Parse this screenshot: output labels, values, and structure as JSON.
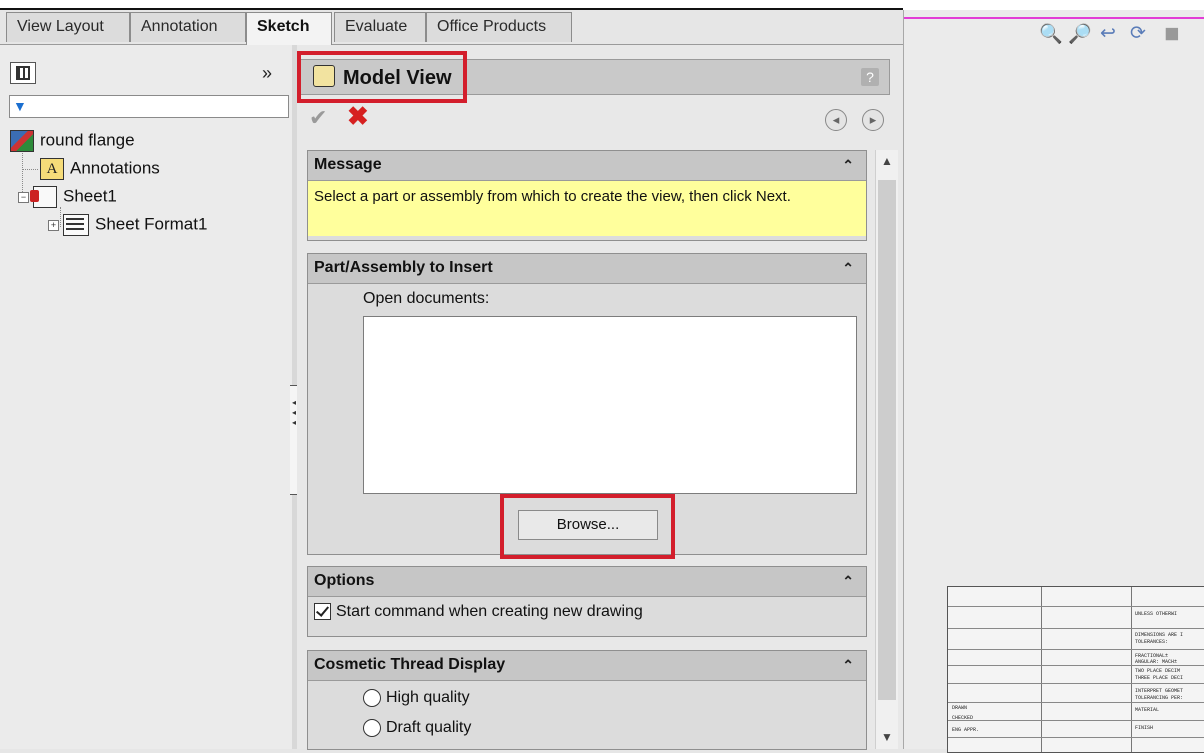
{
  "tabs": [
    {
      "label": "View Layout",
      "active": false
    },
    {
      "label": "Annotation",
      "active": false
    },
    {
      "label": "Sketch",
      "active": true
    },
    {
      "label": "Evaluate",
      "active": false
    },
    {
      "label": "Office Products",
      "active": false
    }
  ],
  "feature_tree": {
    "expand_symbol": "»",
    "filter_placeholder": "",
    "root": "round flange",
    "items": [
      "Annotations",
      "Sheet1",
      "Sheet Format1"
    ]
  },
  "property_manager": {
    "title": "Model View",
    "help": "?",
    "message": {
      "header": "Message",
      "text": "Select a part or assembly from which to create the view, then click Next."
    },
    "part_assembly": {
      "header": "Part/Assembly to Insert",
      "open_docs_label": "Open documents:",
      "browse_label": "Browse..."
    },
    "options": {
      "header": "Options",
      "start_command_label": "Start command when creating new drawing",
      "start_command_checked": true
    },
    "cosmetic": {
      "header": "Cosmetic Thread Display",
      "high_label": "High quality",
      "draft_label": "Draft quality"
    }
  },
  "title_block": {
    "lines": [
      "UNLESS OTHERWI",
      "DIMENSIONS ARE I",
      "TOLERANCES:",
      "FRACTIONAL±",
      "ANGULAR: MACH±",
      "TWO PLACE DECIM",
      "THREE PLACE DECI",
      "INTERPRET GEOMET",
      "TOLERANCING PER:",
      "MATERIAL",
      "FINISH",
      "DRAWN",
      "CHECKED",
      "ENG APPR."
    ]
  },
  "colors": {
    "accent_red": "#d31e2c",
    "message_bg": "#ffff9c",
    "magenta": "#e23ed6"
  }
}
